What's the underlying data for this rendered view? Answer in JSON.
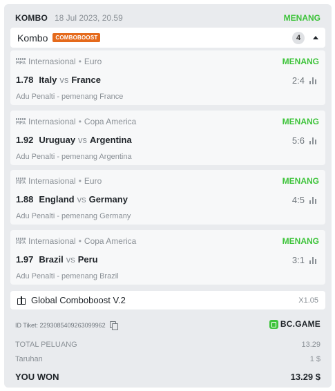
{
  "header": {
    "type_label": "KOMBO",
    "datetime": "18 Jul 2023, 20.59",
    "status": "MENANG"
  },
  "combo": {
    "title": "Kombo",
    "badge": "COMBOBOOST",
    "count": "4"
  },
  "matches": [
    {
      "category": "Internasional",
      "league": "Euro",
      "status": "MENANG",
      "odds": "1.78",
      "home": "Italy",
      "vs": "vs",
      "away": "France",
      "score": "2:4",
      "pick": "Adu Penalti - pemenang France"
    },
    {
      "category": "Internasional",
      "league": "Copa America",
      "status": "MENANG",
      "odds": "1.92",
      "home": "Uruguay",
      "vs": "vs",
      "away": "Argentina",
      "score": "5:6",
      "pick": "Adu Penalti - pemenang Argentina"
    },
    {
      "category": "Internasional",
      "league": "Euro",
      "status": "MENANG",
      "odds": "1.88",
      "home": "England",
      "vs": "vs",
      "away": "Germany",
      "score": "4:5",
      "pick": "Adu Penalti - pemenang Germany"
    },
    {
      "category": "Internasional",
      "league": "Copa America",
      "status": "MENANG",
      "odds": "1.97",
      "home": "Brazil",
      "vs": "vs",
      "away": "Peru",
      "score": "3:1",
      "pick": "Adu Penalti - pemenang Brazil"
    }
  ],
  "boost": {
    "name": "Global Comboboost V.2",
    "multiplier": "X1.05"
  },
  "ticket": {
    "label": "ID Tiket: 2293085409263099962",
    "brand": "BC.GAME"
  },
  "summary": {
    "total_label": "TOTAL PELUANG",
    "total_value": "13.29",
    "stake_label": "Taruhan",
    "stake_value": "1 $",
    "won_label": "YOU WON",
    "won_value": "13.29 $"
  },
  "colors": {
    "win": "#3dc33a",
    "badge": "#e56a1c",
    "card_bg": "#e9ebee"
  }
}
